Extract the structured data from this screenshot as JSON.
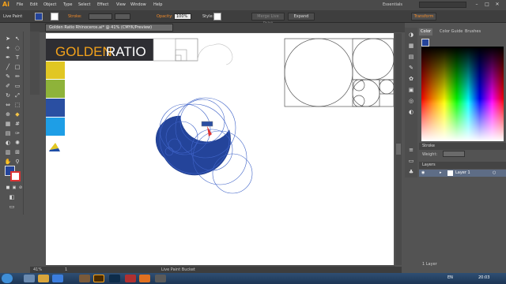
{
  "app": {
    "logo": "Ai"
  },
  "menubar": {
    "items": [
      "File",
      "Edit",
      "Object",
      "Type",
      "Select",
      "Effect",
      "View",
      "Window",
      "Help"
    ],
    "workspace": "Essentials"
  },
  "control": {
    "tool_label": "Live Paint",
    "stroke_label": "Stroke:",
    "opacity_label": "Opacity:",
    "opacity_value": "100%",
    "style_label": "Style:",
    "merge_label": "Merge Live Paint",
    "expand_label": "Expand",
    "transform_label": "Transform"
  },
  "document": {
    "tab_title": "Golden Ratio Rhinoceros.ai* @ 41% (CMYK/Preview)",
    "tab_close": "×"
  },
  "artboard": {
    "title_left": "GOLDEN",
    "title_right": "RATIO",
    "swatches": [
      "#e1c723",
      "#8eb33a",
      "#2a4fa2",
      "#1e9ee6"
    ]
  },
  "status": {
    "zoom": "41%",
    "page": "1",
    "tool_name": "Live Paint Bucket"
  },
  "panels": {
    "color_tabs": [
      "Color",
      "Color Guide",
      "Brushes"
    ],
    "stroke_title": "Stroke",
    "weight_label": "Weight:",
    "layers_title": "Layers",
    "layer_name": "Layer 1",
    "layers_count": "1 Layer"
  },
  "taskbar": {
    "lang": "EN",
    "clock": "20:03"
  },
  "colors": {
    "fill": "#24449a",
    "accent": "#f08a2a"
  }
}
